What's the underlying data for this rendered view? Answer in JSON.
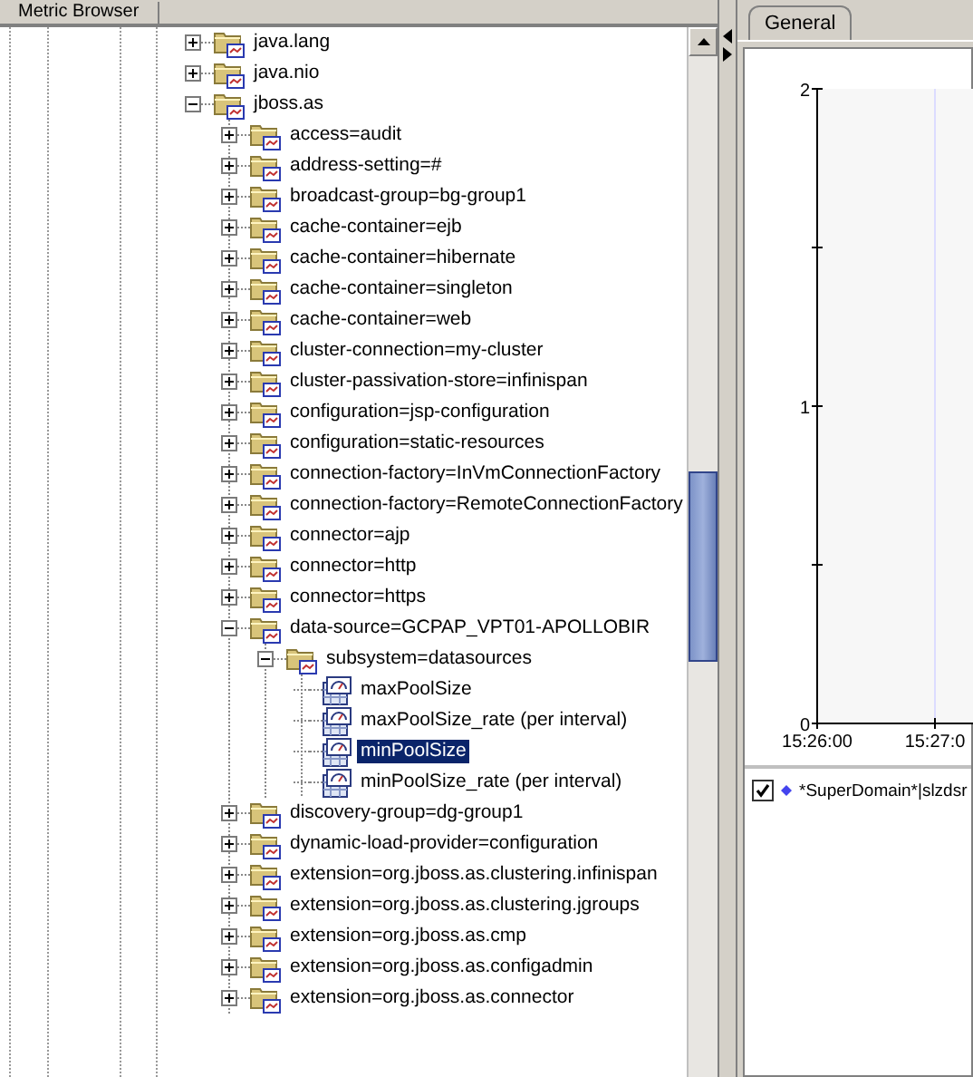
{
  "left_panel": {
    "tab": {
      "label": "Metric Browser",
      "selected": true
    }
  },
  "tree": [
    {
      "label": "java.lang",
      "kind": "folder",
      "expanded": false,
      "selected": false
    },
    {
      "label": "java.nio",
      "kind": "folder",
      "expanded": false,
      "selected": false
    },
    {
      "label": "jboss.as",
      "kind": "folder",
      "expanded": true,
      "selected": false,
      "children": [
        {
          "label": "access=audit",
          "kind": "folder",
          "expanded": false,
          "selected": false
        },
        {
          "label": "address-setting=#",
          "kind": "folder",
          "expanded": false,
          "selected": false
        },
        {
          "label": "broadcast-group=bg-group1",
          "kind": "folder",
          "expanded": false,
          "selected": false
        },
        {
          "label": "cache-container=ejb",
          "kind": "folder",
          "expanded": false,
          "selected": false
        },
        {
          "label": "cache-container=hibernate",
          "kind": "folder",
          "expanded": false,
          "selected": false
        },
        {
          "label": "cache-container=singleton",
          "kind": "folder",
          "expanded": false,
          "selected": false
        },
        {
          "label": "cache-container=web",
          "kind": "folder",
          "expanded": false,
          "selected": false
        },
        {
          "label": "cluster-connection=my-cluster",
          "kind": "folder",
          "expanded": false,
          "selected": false
        },
        {
          "label": "cluster-passivation-store=infinispan",
          "kind": "folder",
          "expanded": false,
          "selected": false
        },
        {
          "label": "configuration=jsp-configuration",
          "kind": "folder",
          "expanded": false,
          "selected": false
        },
        {
          "label": "configuration=static-resources",
          "kind": "folder",
          "expanded": false,
          "selected": false
        },
        {
          "label": "connection-factory=InVmConnectionFactory",
          "kind": "folder",
          "expanded": false,
          "selected": false
        },
        {
          "label": "connection-factory=RemoteConnectionFactory",
          "kind": "folder",
          "expanded": false,
          "selected": false
        },
        {
          "label": "connector=ajp",
          "kind": "folder",
          "expanded": false,
          "selected": false
        },
        {
          "label": "connector=http",
          "kind": "folder",
          "expanded": false,
          "selected": false
        },
        {
          "label": "connector=https",
          "kind": "folder",
          "expanded": false,
          "selected": false
        },
        {
          "label": "data-source=GCPAP_VPT01-APOLLOBIR",
          "kind": "folder",
          "expanded": true,
          "selected": false,
          "children": [
            {
              "label": "subsystem=datasources",
              "kind": "folder",
              "expanded": true,
              "selected": false,
              "children": [
                {
                  "label": "maxPoolSize",
                  "kind": "metric",
                  "selected": false
                },
                {
                  "label": "maxPoolSize_rate (per interval)",
                  "kind": "metric",
                  "selected": false
                },
                {
                  "label": "minPoolSize",
                  "kind": "metric",
                  "selected": true
                },
                {
                  "label": "minPoolSize_rate (per interval)",
                  "kind": "metric",
                  "selected": false
                }
              ]
            }
          ]
        },
        {
          "label": "discovery-group=dg-group1",
          "kind": "folder",
          "expanded": false,
          "selected": false
        },
        {
          "label": "dynamic-load-provider=configuration",
          "kind": "folder",
          "expanded": false,
          "selected": false
        },
        {
          "label": "extension=org.jboss.as.clustering.infinispan",
          "kind": "folder",
          "expanded": false,
          "selected": false
        },
        {
          "label": "extension=org.jboss.as.clustering.jgroups",
          "kind": "folder",
          "expanded": false,
          "selected": false
        },
        {
          "label": "extension=org.jboss.as.cmp",
          "kind": "folder",
          "expanded": false,
          "selected": false
        },
        {
          "label": "extension=org.jboss.as.configadmin",
          "kind": "folder",
          "expanded": false,
          "selected": false
        },
        {
          "label": "extension=org.jboss.as.connector",
          "kind": "folder",
          "expanded": false,
          "selected": false
        }
      ]
    }
  ],
  "right_panel": {
    "tab": {
      "label": "General",
      "selected": true
    },
    "chart": {
      "chart_data": {
        "type": "line",
        "ylim": [
          0,
          2
        ],
        "yticks": [
          0,
          1,
          2
        ],
        "categories": [
          "15:26:00",
          "15:27:0"
        ]
      }
    },
    "legend": [
      {
        "checked": true,
        "color": "#4444ee",
        "label": "*SuperDomain*|slzdsr"
      }
    ]
  }
}
